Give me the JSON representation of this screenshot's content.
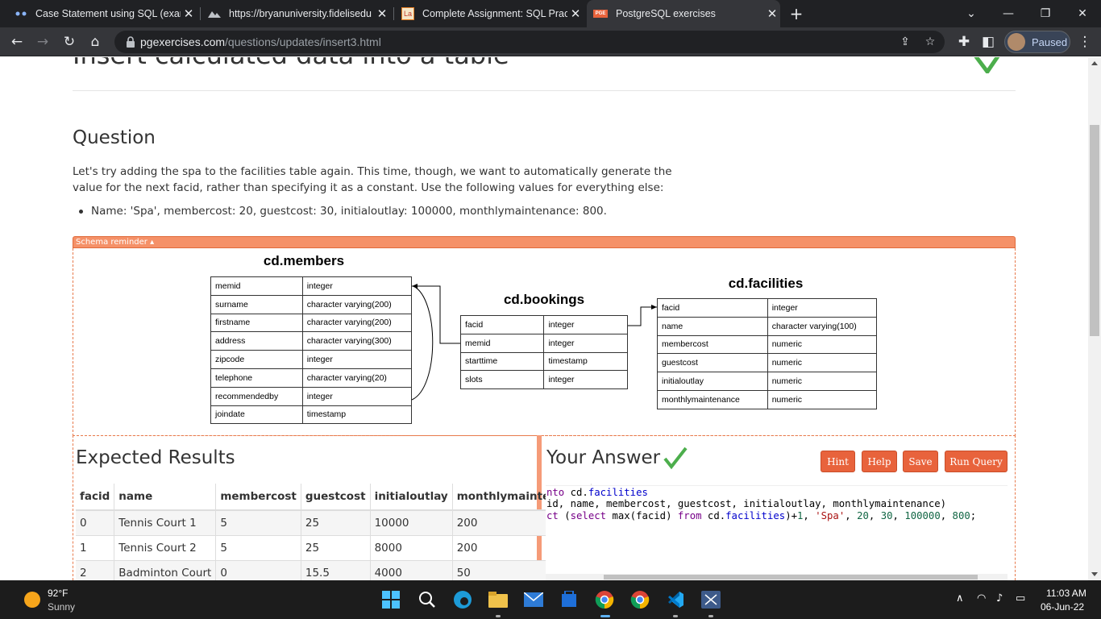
{
  "browser": {
    "tabs": [
      {
        "title": "Case Statement using SQL (exam",
        "favicon": "dots-icon"
      },
      {
        "title": "https://bryanuniversity.fidelisedu",
        "favicon": "mountain-icon"
      },
      {
        "title": "Complete Assignment: SQL Pract",
        "favicon": "la-icon",
        "favicon_text": "La"
      },
      {
        "title": "PostgreSQL exercises",
        "favicon": "pge-icon",
        "favicon_text": "PGE"
      }
    ],
    "url_host": "pgexercises.com",
    "url_path": "/questions/updates/insert3.html",
    "profile_label": "Paused"
  },
  "page": {
    "heading": "Insert calculated data into a table",
    "question_title": "Question",
    "question_text": "Let's try adding the spa to the facilities table again. This time, though, we want to automatically generate the value for the next facid, rather than specifying it as a constant. Use the following values for everything else:",
    "question_bullet": "Name: 'Spa', membercost: 20, guestcost: 30, initialoutlay: 100000, monthlymaintenance: 800.",
    "schema_label": "Schema reminder ▴",
    "schema": {
      "members": {
        "title": "cd.members",
        "rows": [
          [
            "memid",
            "integer"
          ],
          [
            "surname",
            "character varying(200)"
          ],
          [
            "firstname",
            "character varying(200)"
          ],
          [
            "address",
            "character varying(300)"
          ],
          [
            "zipcode",
            "integer"
          ],
          [
            "telephone",
            "character varying(20)"
          ],
          [
            "recommendedby",
            "integer"
          ],
          [
            "joindate",
            "timestamp"
          ]
        ]
      },
      "bookings": {
        "title": "cd.bookings",
        "rows": [
          [
            "facid",
            "integer"
          ],
          [
            "memid",
            "integer"
          ],
          [
            "starttime",
            "timestamp"
          ],
          [
            "slots",
            "integer"
          ]
        ]
      },
      "facilities": {
        "title": "cd.facilities",
        "rows": [
          [
            "facid",
            "integer"
          ],
          [
            "name",
            "character varying(100)"
          ],
          [
            "membercost",
            "numeric"
          ],
          [
            "guestcost",
            "numeric"
          ],
          [
            "initialoutlay",
            "numeric"
          ],
          [
            "monthlymaintenance",
            "numeric"
          ]
        ]
      }
    },
    "expected_title": "Expected Results",
    "results": {
      "headers": [
        "facid",
        "name",
        "membercost",
        "guestcost",
        "initialoutlay",
        "monthlymaintenance"
      ],
      "rows": [
        [
          "0",
          "Tennis Court 1",
          "5",
          "25",
          "10000",
          "200"
        ],
        [
          "1",
          "Tennis Court 2",
          "5",
          "25",
          "8000",
          "200"
        ],
        [
          "2",
          "Badminton Court",
          "0",
          "15.5",
          "4000",
          "50"
        ]
      ]
    },
    "answer_title": "Your Answer",
    "buttons": {
      "hint": "Hint",
      "help": "Help",
      "save": "Save",
      "run": "Run Query"
    },
    "code_lines": [
      "nto cd.facilities",
      "id, name, membercost, guestcost, initialoutlay, monthlymaintenance)",
      "ct (select max(facid) from cd.facilities)+1, 'Spa', 20, 30, 100000, 800;"
    ]
  },
  "taskbar": {
    "temperature": "92°F",
    "condition": "Sunny",
    "time": "11:03 AM",
    "date": "06-Jun-22"
  }
}
